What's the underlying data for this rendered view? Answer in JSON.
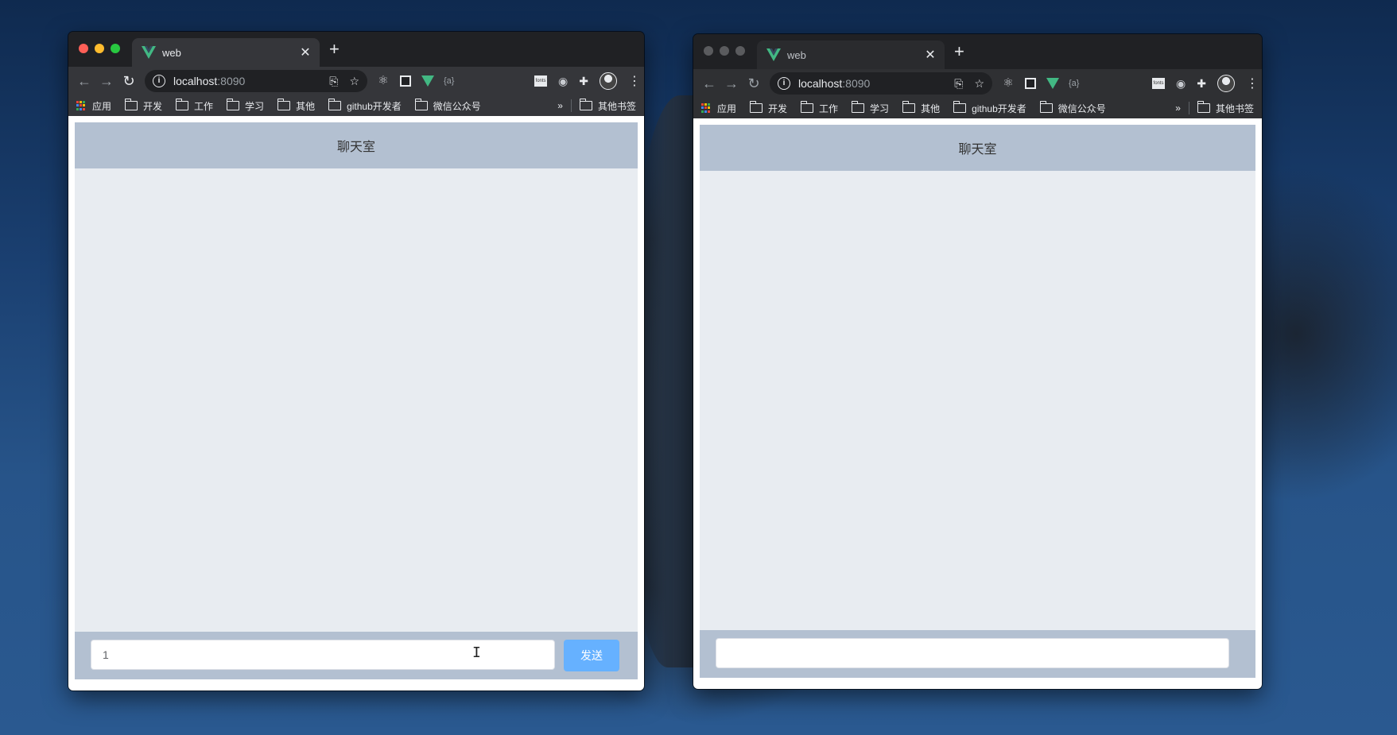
{
  "windows": [
    {
      "id": "left",
      "tab": {
        "title": "web"
      },
      "address": {
        "host": "localhost",
        "port": ":8090"
      },
      "bookmarks": {
        "apps": "应用",
        "folders": [
          "开发",
          "工作",
          "学习",
          "其他",
          "github开发者",
          "微信公众号"
        ],
        "more": "»",
        "other": "其他书签"
      },
      "chat": {
        "title": "聊天室",
        "input_value": "1",
        "send_label": "发送"
      }
    },
    {
      "id": "right",
      "tab": {
        "title": "web"
      },
      "address": {
        "host": "localhost",
        "port": ":8090"
      },
      "bookmarks": {
        "apps": "应用",
        "folders": [
          "开发",
          "工作",
          "学习",
          "其他",
          "github开发者",
          "微信公众号"
        ],
        "more": "»",
        "other": "其他书签"
      },
      "chat": {
        "title": "聊天室",
        "input_value": ""
      }
    }
  ],
  "colors": {
    "chat_header": "#b3c0d1",
    "chat_body": "#e8ecf1",
    "send_button": "#66b1ff",
    "vue_green": "#42b883"
  },
  "icons": {
    "tab_favicon": "vue-logo-icon",
    "extensions": [
      "translate-icon",
      "star-icon",
      "react-devtools-icon",
      "square-extension-icon",
      "vue-devtools-icon",
      "json-braces-icon",
      "fonts-icon",
      "camera-icon",
      "puzzle-icon",
      "avatar-icon",
      "kebab-menu-icon"
    ]
  }
}
